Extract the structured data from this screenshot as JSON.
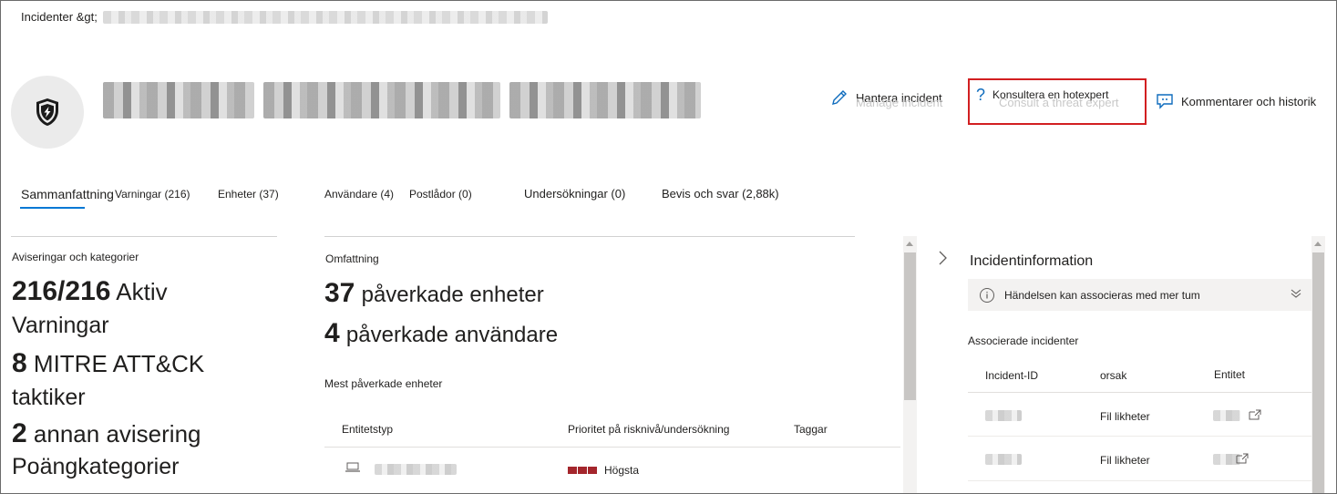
{
  "breadcrumb": {
    "root": "Incidenter &gt;"
  },
  "header": {
    "actions": {
      "manage": "Hantera incident",
      "manage_ghost": "Manage incident",
      "consult": "Konsultera en hotexpert",
      "consult_ghost": "Consult a threat expert",
      "comments": "Kommentarer och historik"
    },
    "highlight_color": "#d21f21"
  },
  "tabs": [
    {
      "label": "Sammanfattning",
      "active": true
    },
    {
      "label": "Varningar (216)"
    },
    {
      "label": "Enheter (37)"
    },
    {
      "label": "Användare (4)"
    },
    {
      "label": "Postlådor (0)"
    },
    {
      "label": "Undersökningar (0)"
    },
    {
      "label": "Bevis och svar (2,88k)"
    }
  ],
  "summary": {
    "heading": "Aviseringar och kategorier",
    "alerts_count": "216/216",
    "alerts_word": "Aktiv",
    "alerts_sub": "Varningar",
    "mitre_count": "8",
    "mitre_word": "MITRE ATT&CK",
    "mitre_sub": "taktiker",
    "other_count": "2",
    "other_word": "annan avisering",
    "other_sub": "Poängkategorier"
  },
  "scope": {
    "heading": "Omfattning",
    "devices_count": "37",
    "devices_label": "påverkade enheter",
    "users_count": "4",
    "users_label": "påverkade användare",
    "most_affected": "Mest påverkade enheter",
    "columns": [
      "Entitetstyp",
      "Prioritet på risknivå/undersökning",
      "Taggar"
    ],
    "rows": [
      {
        "priority": "Högsta"
      }
    ],
    "priority_color": "#a4262c"
  },
  "incident_info": {
    "title": "Incidentinformation",
    "banner": "Händelsen kan associeras med mer tum",
    "associated_heading": "Associerade incidenter",
    "columns": [
      "Incident-ID",
      "orsak",
      "Entitet"
    ],
    "rows": [
      {
        "reason": "Fil likheter"
      },
      {
        "reason": "Fil likheter"
      }
    ]
  }
}
